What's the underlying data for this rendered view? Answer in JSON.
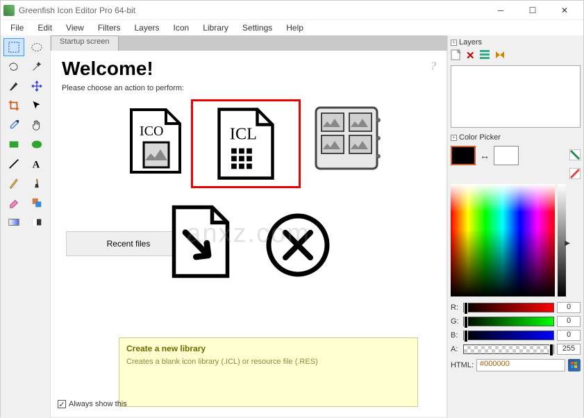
{
  "window": {
    "title": "Greenfish Icon Editor Pro 64-bit"
  },
  "menu": [
    "File",
    "Edit",
    "View",
    "Filters",
    "Layers",
    "Icon",
    "Library",
    "Settings",
    "Help"
  ],
  "tab": {
    "label": "Startup screen"
  },
  "welcome": {
    "title": "Welcome!",
    "subtitle": "Please choose an action to perform:",
    "recent": "Recent files",
    "always": "Always show this",
    "hint_title": "Create a new library",
    "hint_body": "Creates a blank icon library (.ICL) or resource file (.RES)",
    "ico_label": "ICO",
    "icl_label": "ICL"
  },
  "panels": {
    "layers_title": "Layers",
    "picker_title": "Color Picker"
  },
  "color": {
    "r_label": "R:",
    "g_label": "G:",
    "b_label": "B:",
    "a_label": "A:",
    "r": "0",
    "g": "0",
    "b": "0",
    "a": "255",
    "html_label": "HTML:",
    "html_value": "#000000"
  },
  "watermark": "anxz.com"
}
